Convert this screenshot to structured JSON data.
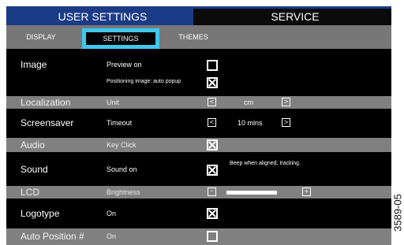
{
  "tabs": {
    "user_settings": "USER SETTINGS",
    "service": "SERVICE"
  },
  "subtabs": {
    "display": "DISPLAY",
    "settings": "SETTINGS",
    "themes": "THEMES"
  },
  "rows": {
    "image": {
      "title": "Image",
      "preview_label": "Preview on",
      "preview_checked": false,
      "positioning_label": "Positioning image: auto popup",
      "positioning_checked": true
    },
    "localization": {
      "title": "Localization",
      "setting": "Unit",
      "value": "cm"
    },
    "screensaver": {
      "title": "Screensaver",
      "setting": "Timeout",
      "value": "10 mins"
    },
    "audio": {
      "title": "Audio",
      "setting": "Key Click",
      "checked": true
    },
    "sound": {
      "title": "Sound",
      "setting": "Sound on",
      "checked": true,
      "note": "Beep when aligned, tracking."
    },
    "lcd": {
      "title": "LCD",
      "setting": "Brightness",
      "level": 0.7,
      "minus": "-",
      "plus": "+"
    },
    "logotype": {
      "title": "Logotype",
      "setting": "On",
      "checked": true
    },
    "auto_position": {
      "title": "Auto Position #",
      "setting": "On",
      "checked": false
    }
  },
  "arrows": {
    "left": "<",
    "right": ">"
  },
  "figure_code": "3589-05",
  "colors": {
    "tab_active": "#1a3b86",
    "highlight": "#3fc8ee",
    "grey_row": "#808080"
  }
}
